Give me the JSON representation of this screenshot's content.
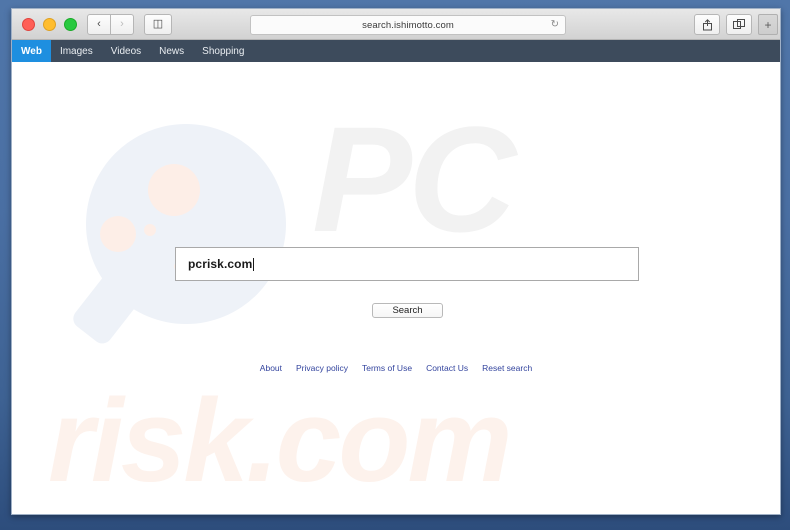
{
  "browser": {
    "traffic_lights": [
      "close",
      "minimize",
      "zoom"
    ],
    "back_label": "‹",
    "forward_label": "›",
    "sidebar_label": "◫",
    "url": "search.ishimotto.com",
    "reload_label": "↻",
    "share_label": "⇧",
    "tabs_label": "❐",
    "new_tab_label": "+"
  },
  "site_nav": {
    "items": [
      {
        "label": "Web",
        "active": true
      },
      {
        "label": "Images",
        "active": false
      },
      {
        "label": "Videos",
        "active": false
      },
      {
        "label": "News",
        "active": false
      },
      {
        "label": "Shopping",
        "active": false
      }
    ]
  },
  "search": {
    "query": "pcrisk.com",
    "placeholder": "",
    "button_label": "Search"
  },
  "footer": {
    "links": [
      "About",
      "Privacy policy",
      "Terms of Use",
      "Contact Us",
      "Reset search"
    ]
  },
  "watermark": {
    "top_text": "PC",
    "bottom_text": "risk.com"
  },
  "colors": {
    "nav_bar": "#3d4b5c",
    "nav_active": "#1e8fe0",
    "link": "#33449e",
    "desktop": "#4a6fa3",
    "watermark_grey": "#f2f2f2",
    "watermark_peach": "#fdf2ec",
    "watermark_blue": "#eef2f8"
  }
}
